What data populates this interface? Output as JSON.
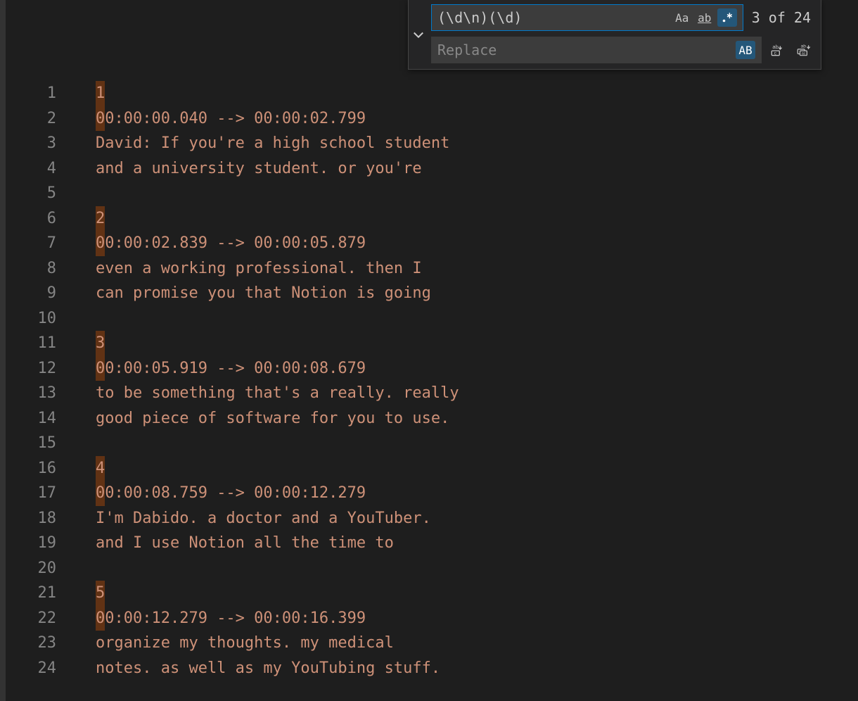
{
  "find": {
    "search_value": "(\\d\\n)(\\d)",
    "replace_placeholder": "Replace",
    "match_count": "3 of 24",
    "options": {
      "case_sensitive": "Aa",
      "whole_word": "ab",
      "regex_active": true,
      "preserve_case": "AB"
    }
  },
  "editor": {
    "line_count": 24,
    "lines": [
      {
        "n": 1,
        "text": "1",
        "highlighted_chars": [
          0
        ]
      },
      {
        "n": 2,
        "text": "00:00:00.040 --> 00:00:02.799",
        "highlighted_chars": [
          0
        ]
      },
      {
        "n": 3,
        "text": "David: If you're a high school student"
      },
      {
        "n": 4,
        "text": "and a university student. or you're"
      },
      {
        "n": 5,
        "text": ""
      },
      {
        "n": 6,
        "text": "2",
        "highlighted_chars": [
          0
        ]
      },
      {
        "n": 7,
        "text": "00:00:02.839 --> 00:00:05.879",
        "highlighted_chars": [
          0
        ]
      },
      {
        "n": 8,
        "text": "even a working professional. then I"
      },
      {
        "n": 9,
        "text": "can promise you that Notion is going"
      },
      {
        "n": 10,
        "text": ""
      },
      {
        "n": 11,
        "text": "3",
        "highlighted_chars": [
          0
        ]
      },
      {
        "n": 12,
        "text": "00:00:05.919 --> 00:00:08.679",
        "highlighted_chars": [
          0
        ]
      },
      {
        "n": 13,
        "text": "to be something that's a really. really"
      },
      {
        "n": 14,
        "text": "good piece of software for you to use."
      },
      {
        "n": 15,
        "text": ""
      },
      {
        "n": 16,
        "text": "4",
        "highlighted_chars": [
          0
        ]
      },
      {
        "n": 17,
        "text": "00:00:08.759 --> 00:00:12.279",
        "highlighted_chars": [
          0
        ]
      },
      {
        "n": 18,
        "text": "I'm Dabido. a doctor and a YouTuber."
      },
      {
        "n": 19,
        "text": "and I use Notion all the time to"
      },
      {
        "n": 20,
        "text": ""
      },
      {
        "n": 21,
        "text": "5",
        "highlighted_chars": [
          0
        ]
      },
      {
        "n": 22,
        "text": "00:00:12.279 --> 00:00:16.399",
        "highlighted_chars": [
          0
        ]
      },
      {
        "n": 23,
        "text": "organize my thoughts. my medical"
      },
      {
        "n": 24,
        "text": "notes. as well as my YouTubing stuff."
      }
    ]
  }
}
